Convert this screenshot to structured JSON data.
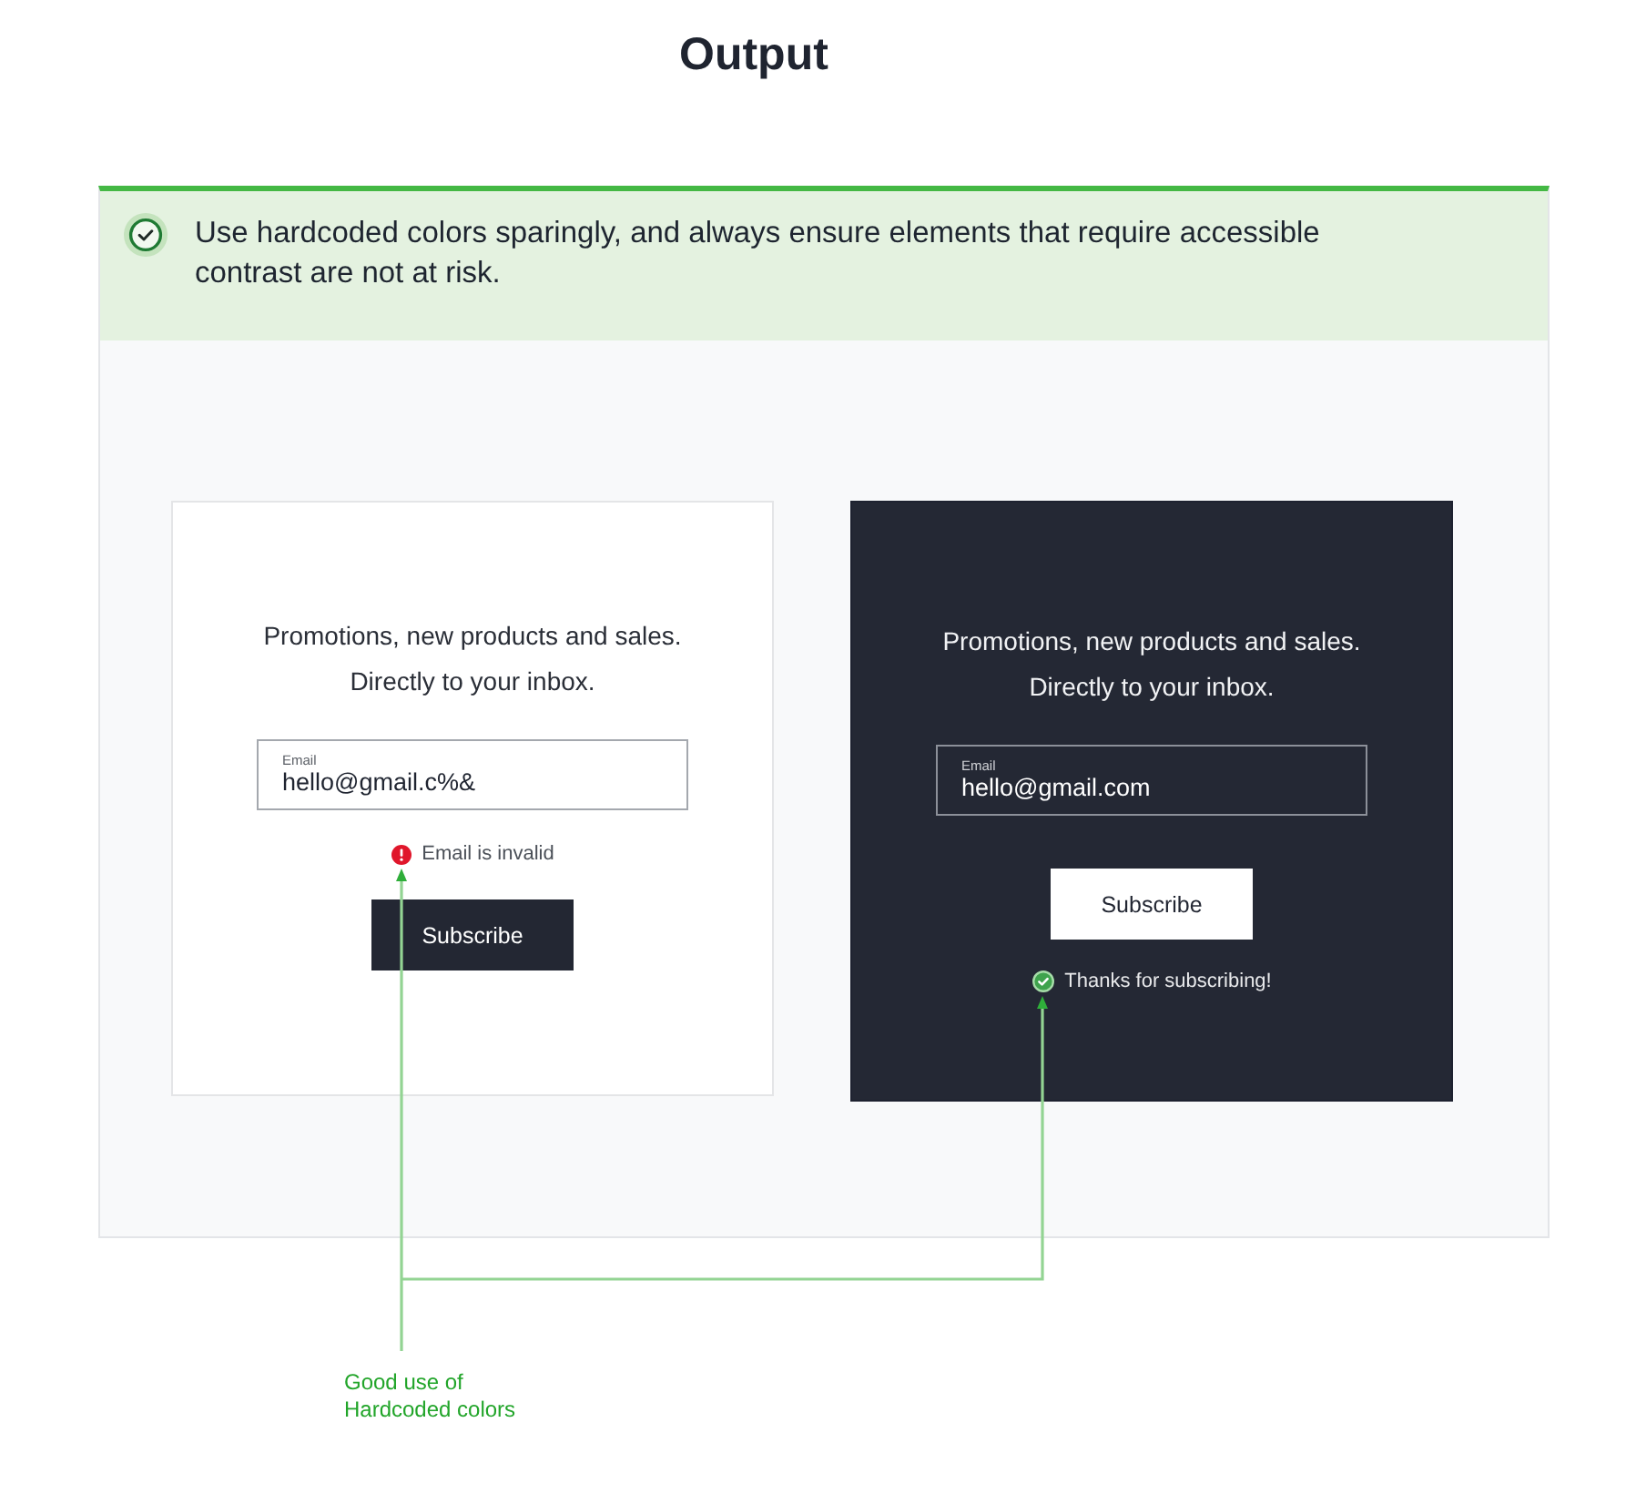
{
  "title": "Output",
  "banner": {
    "kind": "success",
    "text": "Use hardcoded colors sparingly, and always ensure elements that require accessible contrast are not at risk."
  },
  "cards": [
    {
      "dark": false,
      "heading": [
        "Promotions, new products and sales.",
        "Directly to your inbox."
      ],
      "email_field": {
        "label": "Email",
        "value": "hello@gmail.c%&"
      },
      "message": {
        "kind": "error",
        "text": "Email is invalid"
      },
      "button": "Subscribe"
    },
    {
      "dark": true,
      "heading": [
        "Promotions, new products and sales.",
        "Directly to your inbox."
      ],
      "email_field": {
        "label": "Email",
        "value": "hello@gmail.com"
      },
      "message": {
        "kind": "success",
        "text": "Thanks for subscribing!"
      },
      "button": "Subscribe"
    }
  ],
  "annotation": {
    "text": "Good use of Hardcoded colors"
  }
}
